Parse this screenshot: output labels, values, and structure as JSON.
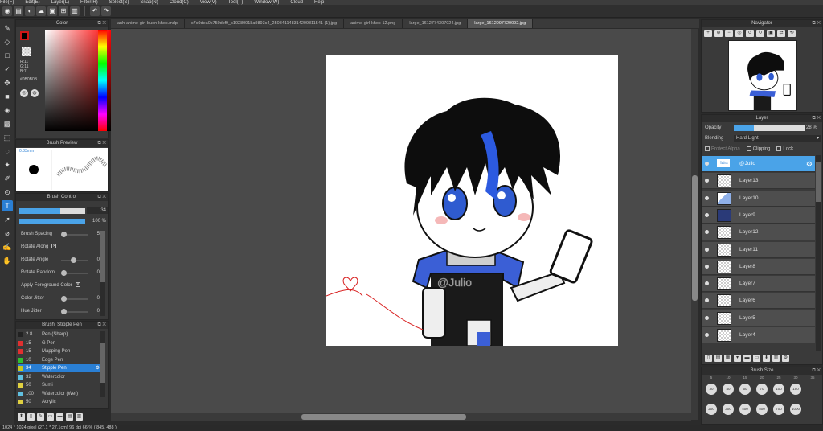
{
  "menu": [
    "File(F)",
    "Edit(E)",
    "Layer(L)",
    "Filter(R)",
    "Select(S)",
    "Snap(N)",
    "Cloud(C)",
    "View(V)",
    "Tool(T)",
    "Window(W)",
    "Cloud",
    "Help"
  ],
  "toolbar": {
    "undo": "↶",
    "redo": "↷"
  },
  "tools": [
    "brush",
    "eraser",
    "rect-select",
    "check",
    "move",
    "fill-rect",
    "bucket",
    "gradient",
    "select",
    "lasso",
    "magic-wand",
    "select-pen",
    "eyedropper",
    "text",
    "operation",
    "dropper",
    "pen-pick",
    "hand"
  ],
  "color_panel": {
    "title": "Color",
    "rgb": [
      "R:11",
      "G:11",
      "B:11"
    ],
    "hex": "#0B0B0B"
  },
  "brush_preview": {
    "title": "Brush Preview",
    "size": "0.33mm"
  },
  "brush_control": {
    "title": "Brush Control",
    "size_value": "34",
    "opacity_value": "100 %",
    "size_fraction": 0.62,
    "opacity_fraction": 1.0,
    "rows": [
      {
        "label": "Brush Spacing",
        "value": "5",
        "knob": 0.0
      },
      {
        "label": "Rotate Along",
        "check": true
      },
      {
        "label": "Rotate Angle",
        "value": "0",
        "knob": 0.45
      },
      {
        "label": "Rotate Random",
        "value": "0",
        "knob": 0.0
      },
      {
        "label": "Apply Foreground Color",
        "check": true
      },
      {
        "label": "Color Jitter",
        "value": "0",
        "knob": 0.0
      },
      {
        "label": "Hue Jitter",
        "value": "0",
        "knob": 0.0
      }
    ]
  },
  "brush_list": {
    "title": "Brush: Stipple Pen",
    "items": [
      {
        "size": "2.8",
        "name": "Pen (Sharp)",
        "color": "#222222"
      },
      {
        "size": "15",
        "name": "G Pen",
        "color": "#e03030"
      },
      {
        "size": "15",
        "name": "Mapping Pen",
        "color": "#e03030"
      },
      {
        "size": "10",
        "name": "Edge Pen",
        "color": "#30c030"
      },
      {
        "size": "34",
        "name": "Stipple Pen",
        "color": "#c8c820",
        "active": true
      },
      {
        "size": "32",
        "name": "Watercolor",
        "color": "#60c0e0"
      },
      {
        "size": "50",
        "name": "Sumi",
        "color": "#e0d040"
      },
      {
        "size": "100",
        "name": "Watercolor (Wet)",
        "color": "#60c0e0"
      },
      {
        "size": "50",
        "name": "Acrylic",
        "color": "#e0d040"
      }
    ]
  },
  "tabs": [
    {
      "label": "anh-anime-girl-buon-khoc.mdp",
      "active": false
    },
    {
      "label": "c7c9dea0c750dcf9_c10280018a9893c4_250841148314209811541 (1).jpg",
      "active": false
    },
    {
      "label": "anime-girl-khoc-12.png",
      "active": false
    },
    {
      "label": "large_1612774307024.jpg",
      "active": false
    },
    {
      "label": "large_1612097720092.jpg",
      "active": true
    }
  ],
  "canvas": {
    "watermark": "@Julio"
  },
  "statusbar": "1024 * 1024 pixel   (27.1 * 27.1cm)   96 dpi   66 %   ( 845, 488 )",
  "navigator": {
    "title": "Navigator"
  },
  "layer_panel": {
    "title": "Layer",
    "opacity_label": "Opacity",
    "opacity_value": "28 %",
    "opacity_fraction": 0.28,
    "blending_label": "Blending",
    "blending_value": "Hard Light",
    "opt_protect": "Protect Alpha",
    "opt_clipping": "Clipping",
    "opt_lock": "Lock",
    "layers": [
      {
        "name": "@Julio",
        "badge": "Hairs",
        "active": true,
        "visible": true
      },
      {
        "name": "Layer13",
        "visible": true
      },
      {
        "name": "Layer10",
        "visible": true
      },
      {
        "name": "Layer9",
        "visible": true
      },
      {
        "name": "Layer12",
        "visible": true
      },
      {
        "name": "Layer11",
        "visible": true
      },
      {
        "name": "Layer8",
        "visible": true
      },
      {
        "name": "Layer7",
        "visible": true
      },
      {
        "name": "Layer6",
        "visible": true
      },
      {
        "name": "Layer5",
        "visible": true
      },
      {
        "name": "Layer4",
        "visible": true
      }
    ]
  },
  "brush_size": {
    "title": "Brush Size",
    "header_values": [
      "5",
      "10",
      "15",
      "20",
      "25",
      "30",
      "35"
    ],
    "row1": [
      "30",
      "40",
      "50",
      "70",
      "100",
      "150"
    ],
    "row2": [
      "200",
      "300",
      "400",
      "500",
      "700",
      "1000"
    ]
  }
}
